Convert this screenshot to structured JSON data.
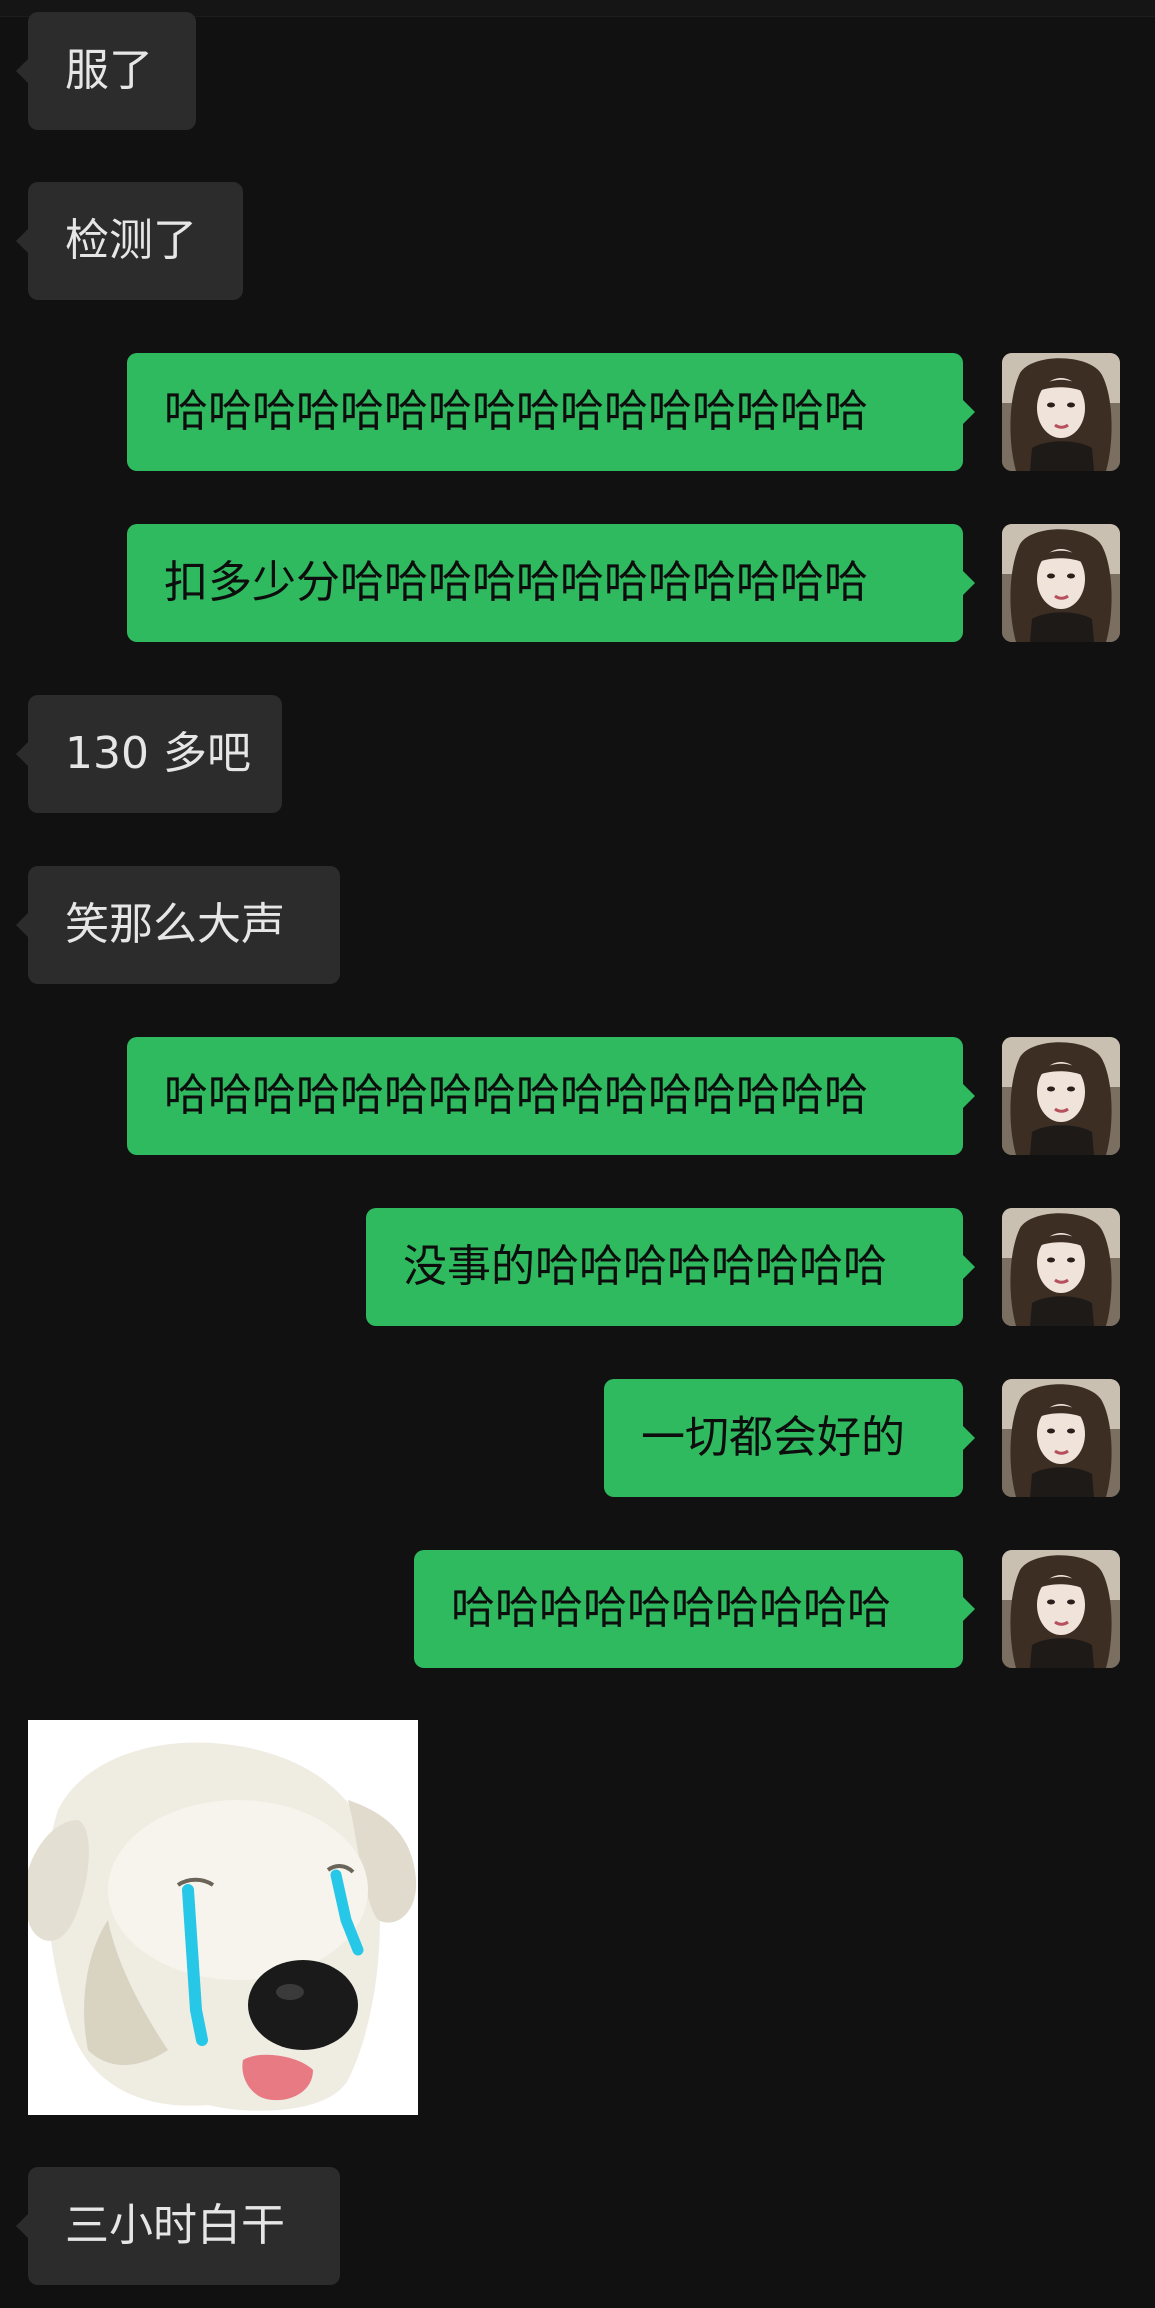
{
  "conversation": {
    "messages": [
      {
        "side": "in",
        "text": "服了"
      },
      {
        "side": "in",
        "text": "检测了"
      },
      {
        "side": "out",
        "text": "哈哈哈哈哈哈哈哈哈哈哈哈哈哈哈哈"
      },
      {
        "side": "out",
        "text": "扣多少分哈哈哈哈哈哈哈哈哈哈哈哈"
      },
      {
        "side": "in",
        "text": "130 多吧"
      },
      {
        "side": "in",
        "text": "笑那么大声"
      },
      {
        "side": "out",
        "text": "哈哈哈哈哈哈哈哈哈哈哈哈哈哈哈哈"
      },
      {
        "side": "out",
        "text": "没事的哈哈哈哈哈哈哈哈"
      },
      {
        "side": "out",
        "text": "一切都会好的"
      },
      {
        "side": "out",
        "text": "哈哈哈哈哈哈哈哈哈哈"
      },
      {
        "side": "in",
        "type": "sticker",
        "icon": "crying-white-dog-sticker"
      },
      {
        "side": "in",
        "text": "三小时白干"
      }
    ]
  },
  "colors": {
    "background": "#111111",
    "incoming_bubble": "#2c2c2c",
    "outgoing_bubble": "#2fba5f"
  },
  "icons": {
    "self_avatar": "user-avatar-icon"
  }
}
